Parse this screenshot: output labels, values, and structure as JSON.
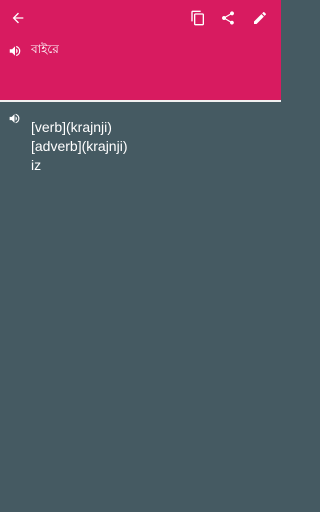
{
  "colors": {
    "accent": "#d81b60",
    "body": "#455a62"
  },
  "header": {
    "icons": {
      "back": "arrow-back-icon",
      "copy": "copy-icon",
      "share": "share-icon",
      "edit": "edit-icon"
    }
  },
  "source": {
    "text": "বাইরে",
    "speaker_icon": "speaker-icon"
  },
  "result": {
    "speaker_icon": "speaker-icon",
    "lines": [
      "[verb](krajnji)",
      "[adverb](krajnji)",
      "iz"
    ]
  }
}
